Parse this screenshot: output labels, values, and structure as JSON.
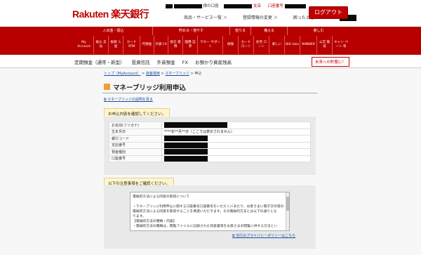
{
  "header": {
    "logo": "Rakuten 楽天銀行",
    "account_suffix": "様の口座",
    "branch_label": "支店",
    "account_no_label": "口座番号",
    "links": [
      "商品・サービス一覧 ＞",
      "登録情報の変更 ＞",
      "困ったときは ＞"
    ],
    "logout": "ログアウト"
  },
  "nav": {
    "groups": [
      "入出金・振込",
      "貯める・増やす",
      "借りる",
      "備える",
      "楽しむ"
    ],
    "items": [
      "My Account",
      "振込 支払",
      "振替 入金",
      "カード ATM",
      "円預金",
      "外貨 FX",
      "投信 運用",
      "国債 証券",
      "マネー サポート",
      "保険",
      "カード ローン",
      "住宅 ローン",
      "楽しい",
      "BIG toto",
      "WINNER",
      "公営 競技",
      "キャン ペーン 等"
    ]
  },
  "subnav": {
    "links": [
      "定期預金（通常・新型）",
      "投資信託",
      "外貨預金",
      "FX",
      "お預かり資産残高"
    ],
    "notice": "未来への貯蓄に！"
  },
  "breadcrumb": {
    "items": [
      "トップ（MyAccount）",
      "資産運用",
      "マネーブリッジ",
      "申込"
    ]
  },
  "page": {
    "title": "マネーブリッジ利用申込",
    "help_link": "マネーブリッジの説明を見る",
    "confirm_heading": "お申込内容を確認してください。",
    "form": [
      {
        "label": "お名前(フリガナ)",
        "value": ""
      },
      {
        "label": "生年月日",
        "value": "****年**月**日（ここでは表示されません）"
      },
      {
        "label": "銀行コード",
        "value": ""
      },
      {
        "label": "支店番号",
        "value": ""
      },
      {
        "label": "預金種別",
        "value": ""
      },
      {
        "label": "口座番号",
        "value": ""
      }
    ],
    "terms_heading": "以下の注意事項をご確認ください。",
    "terms_lines": [
      "電磁的方法による同意の取得について",
      "",
      "・マネーブリッジ利用申込に関する口座番号口座番号をいただくにあたり、お客さまに電子交付等の",
      "電磁的方法による同意を取得することを承諾いただきます。その電磁的方法とは以下の通りとな",
      "ります。",
      "【電磁的方法の種類・内容】",
      "・電磁的方法の種類は、閲覧ファイルに記録された同意書等をお客さまの閲覧に供する方法とい"
    ],
    "privacy_link": "当行のプライバシーポリシーはこちら"
  }
}
